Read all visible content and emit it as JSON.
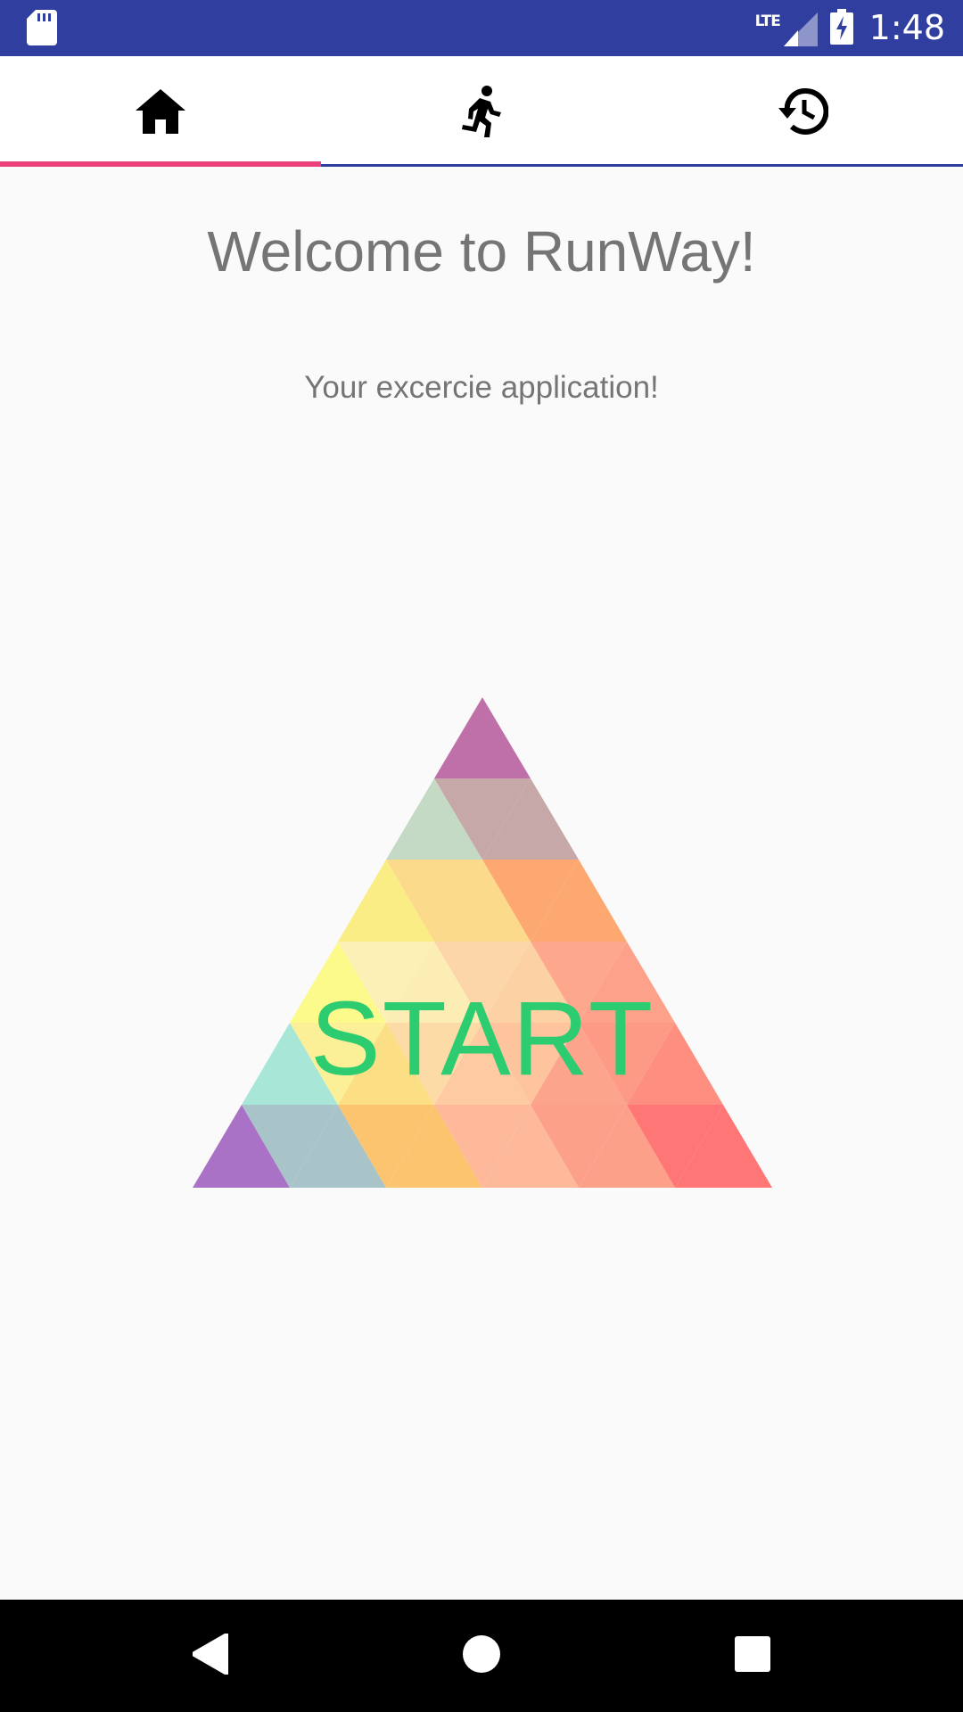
{
  "status_bar": {
    "network": "LTE",
    "time": "1:48",
    "icons": [
      "sd-card-icon",
      "signal-icon",
      "battery-charging-icon"
    ]
  },
  "tabs": [
    {
      "icon": "home-icon",
      "selected": true
    },
    {
      "icon": "running-icon",
      "selected": false
    },
    {
      "icon": "history-icon",
      "selected": false
    }
  ],
  "main": {
    "title": "Welcome to RunWay!",
    "subtitle": "Your excercie application!",
    "start_label": "START"
  },
  "colors": {
    "status_bar": "#303f9f",
    "tab_indicator": "#ec407a",
    "text_gray": "#757575",
    "start_text": "#2ecc71",
    "background": "#fafafa"
  },
  "nav_bar": {
    "icons": [
      "back-icon",
      "home-circle-icon",
      "recents-icon"
    ]
  }
}
